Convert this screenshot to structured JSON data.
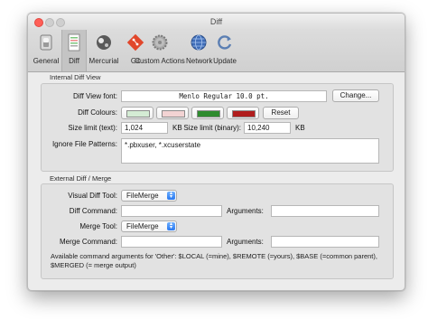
{
  "window": {
    "title": "Diff"
  },
  "toolbar": {
    "items": [
      {
        "label": "General",
        "icon": "switch-icon"
      },
      {
        "label": "Diff",
        "icon": "diff-document-icon",
        "selected": true
      },
      {
        "label": "Mercurial",
        "icon": "mercurial-icon"
      },
      {
        "label": "Git",
        "icon": "git-icon"
      },
      {
        "label": "Custom Actions",
        "icon": "gear-icon"
      },
      {
        "label": "Network",
        "icon": "globe-icon"
      },
      {
        "label": "Update",
        "icon": "refresh-icon"
      }
    ]
  },
  "internal": {
    "title": "Internal Diff View",
    "font_label": "Diff View font:",
    "font_value": "Menlo Regular 10.0 pt.",
    "change_button": "Change...",
    "colours_label": "Diff Colours:",
    "colours": [
      "#d4ecd4",
      "#f2d3d3",
      "#2e8b2e",
      "#b01d1d"
    ],
    "reset_button": "Reset",
    "size_text_label": "Size limit (text):",
    "size_text_value": "1,024",
    "size_text_unit": "KB",
    "size_binary_label": "Size limit (binary):",
    "size_binary_value": "10,240",
    "size_binary_unit": "KB",
    "ignore_label": "Ignore File Patterns:",
    "ignore_value": "*.pbxuser, *.xcuserstate"
  },
  "external": {
    "title": "External Diff / Merge",
    "visual_tool_label": "Visual Diff Tool:",
    "visual_tool_value": "FileMerge",
    "diff_command_label": "Diff Command:",
    "diff_command_value": "",
    "diff_arguments_label": "Arguments:",
    "diff_arguments_value": "",
    "merge_tool_label": "Merge Tool:",
    "merge_tool_value": "FileMerge",
    "merge_command_label": "Merge Command:",
    "merge_command_value": "",
    "merge_arguments_label": "Arguments:",
    "merge_arguments_value": "",
    "help_text": "Available command arguments for 'Other': $LOCAL (=mine), $REMOTE (=yours), $BASE (=common parent), $MERGED (= merge output)"
  }
}
